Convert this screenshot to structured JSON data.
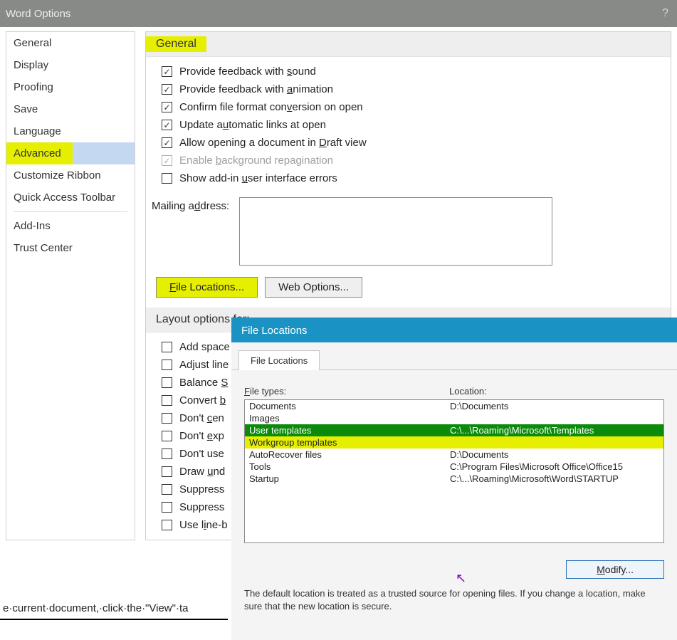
{
  "window": {
    "title": "Word Options",
    "help": "?"
  },
  "sidebar": {
    "items": [
      "General",
      "Display",
      "Proofing",
      "Save",
      "Language",
      "Advanced",
      "Customize Ribbon",
      "Quick Access Toolbar",
      "Add-Ins",
      "Trust Center"
    ],
    "selected_index": 5
  },
  "general_section": {
    "title": "General",
    "options": [
      {
        "label_pre": "Provide feedback with ",
        "u": "s",
        "label_post": "ound",
        "checked": true,
        "disabled": false
      },
      {
        "label_pre": "Provide feedback with ",
        "u": "a",
        "label_post": "nimation",
        "checked": true,
        "disabled": false
      },
      {
        "label_pre": "Confirm file format con",
        "u": "v",
        "label_post": "ersion on open",
        "checked": true,
        "disabled": false
      },
      {
        "label_pre": "Update a",
        "u": "u",
        "label_post": "tomatic links at open",
        "checked": true,
        "disabled": false
      },
      {
        "label_pre": "Allow opening a document in ",
        "u": "D",
        "label_post": "raft view",
        "checked": true,
        "disabled": false
      },
      {
        "label_pre": "Enable ",
        "u": "b",
        "label_post": "ackground repagination",
        "checked": true,
        "disabled": true
      },
      {
        "label_pre": "Show add-in ",
        "u": "u",
        "label_post": "ser interface errors",
        "checked": false,
        "disabled": false
      }
    ],
    "mailing_label_pre": "Mailing a",
    "mailing_u": "d",
    "mailing_label_post": "dress:",
    "file_locations_btn_pre": "",
    "file_locations_u": "F",
    "file_locations_btn_post": "ile Locations...",
    "web_options_btn": "Web Options..."
  },
  "layout_section": {
    "title": "Layout options for:",
    "options": [
      {
        "label": "Add space"
      },
      {
        "label": "Adjust line"
      },
      {
        "label_pre": "Balance ",
        "u": "S"
      },
      {
        "label_pre": "Convert ",
        "u": "b"
      },
      {
        "label_pre": "Don't ",
        "u": "c",
        "label_post": "en"
      },
      {
        "label_pre": "Don't ",
        "u": "e",
        "label_post": "xp"
      },
      {
        "label": "Don't use"
      },
      {
        "label_pre": "Draw ",
        "u": "u",
        "label_post": "nd"
      },
      {
        "label": "Suppress"
      },
      {
        "label": "Suppress"
      },
      {
        "label_pre": "Use l",
        "u": "i",
        "label_post": "ne-b"
      }
    ]
  },
  "bottom_fragment": "e·current·document,·click·the·\"View\"·ta",
  "file_locations_dialog": {
    "title": "File Locations",
    "tab": "File Locations",
    "col_types_pre": "",
    "col_types_u": "F",
    "col_types_post": "ile types:",
    "col_location": "Location:",
    "rows": [
      {
        "type": "Documents",
        "location": "D:\\Documents",
        "state": ""
      },
      {
        "type": "Images",
        "location": "",
        "state": ""
      },
      {
        "type": "User templates",
        "location": "C:\\...\\Roaming\\Microsoft\\Templates",
        "state": "sel-green"
      },
      {
        "type": "Workgroup templates",
        "location": "",
        "state": "hl-yellow"
      },
      {
        "type": "AutoRecover files",
        "location": "D:\\Documents",
        "state": ""
      },
      {
        "type": "Tools",
        "location": "C:\\Program Files\\Microsoft Office\\Office15",
        "state": ""
      },
      {
        "type": "Startup",
        "location": "C:\\...\\Roaming\\Microsoft\\Word\\STARTUP",
        "state": ""
      }
    ],
    "modify_btn_pre": "",
    "modify_u": "M",
    "modify_btn_post": "odify...",
    "note": "The default location is treated as a trusted source for opening files. If you change a location, make sure that the new location is secure."
  }
}
